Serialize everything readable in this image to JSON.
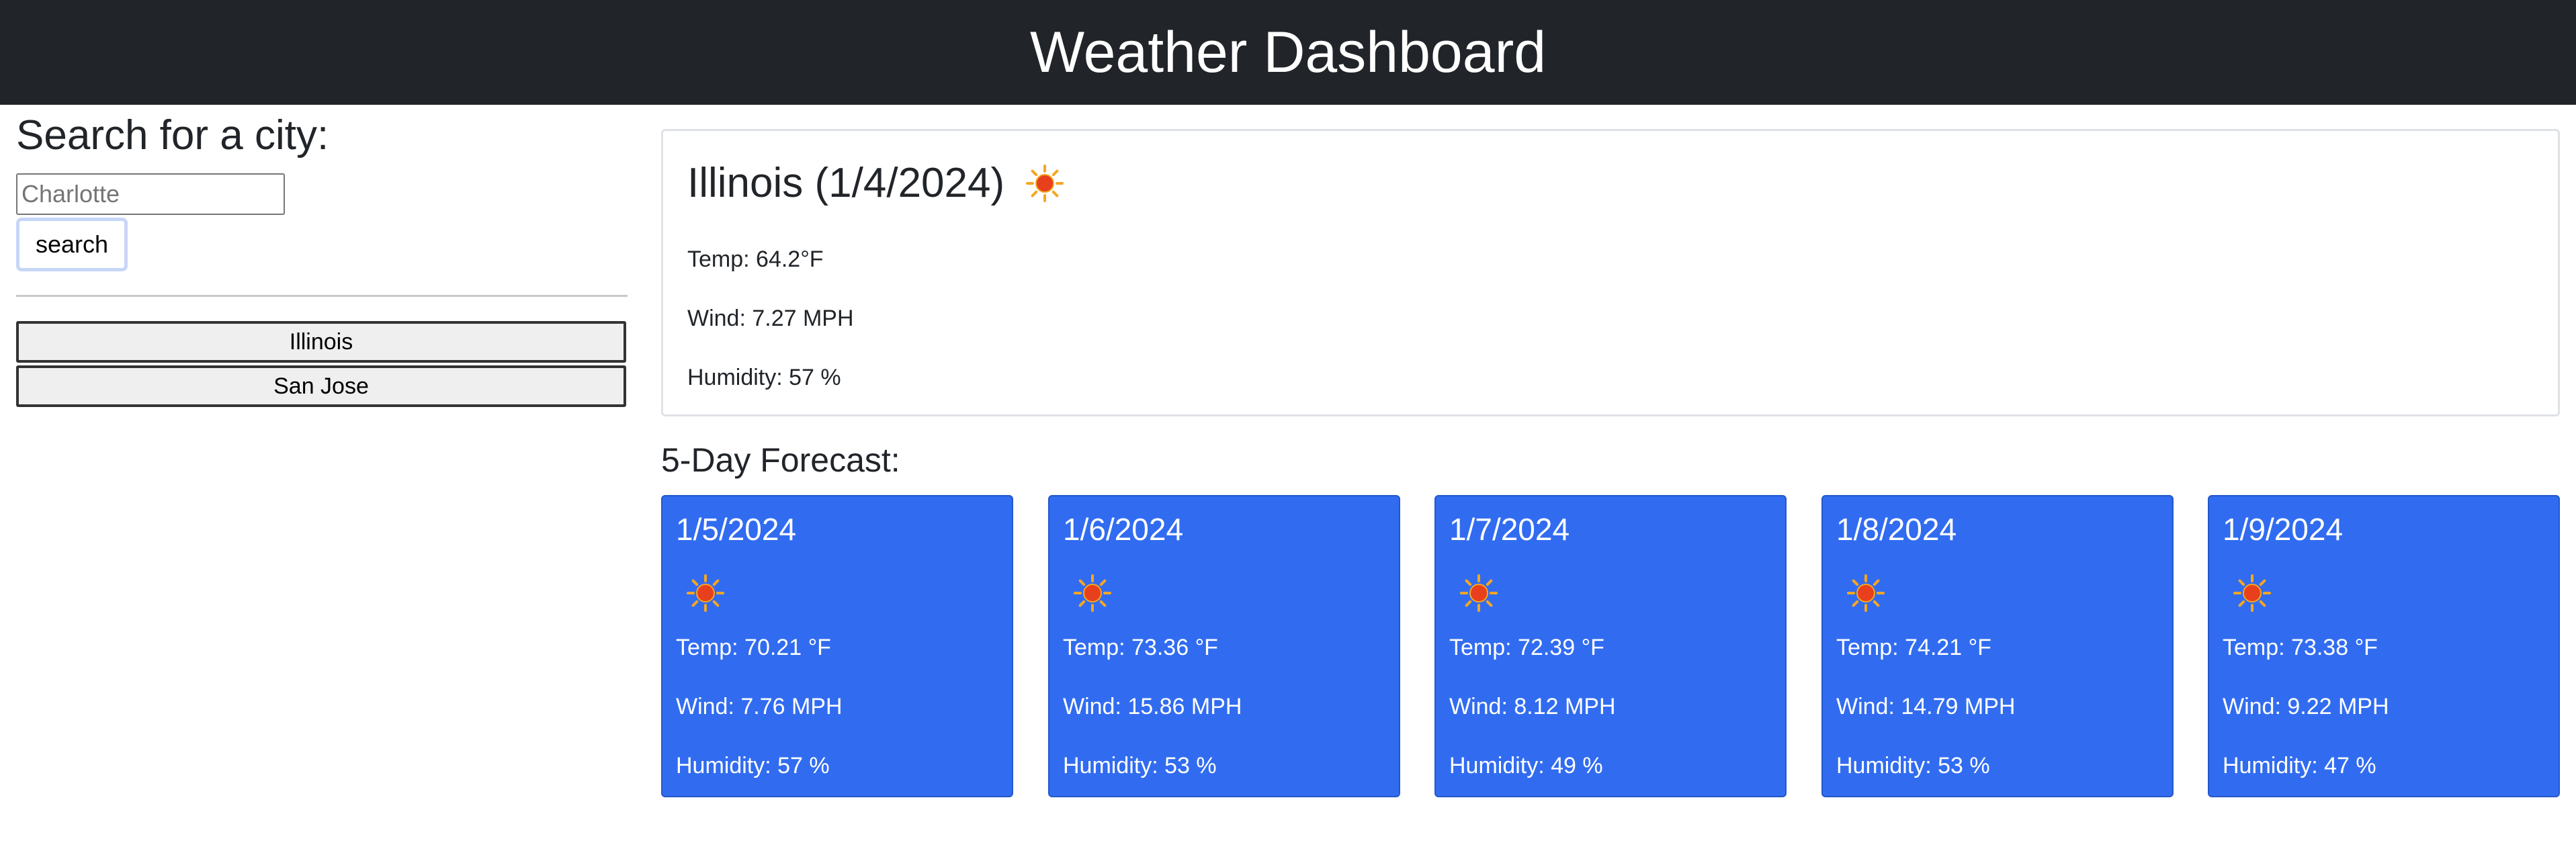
{
  "header": {
    "title": "Weather Dashboard"
  },
  "search": {
    "title": "Search for a city:",
    "placeholder": "Charlotte",
    "button_label": "search"
  },
  "history": [
    {
      "label": "Illinois"
    },
    {
      "label": "San Jose"
    }
  ],
  "current": {
    "title": "Illinois (1/4/2024)",
    "icon": "sun-icon",
    "temp": "Temp: 64.2°F",
    "wind": "Wind: 7.27 MPH",
    "humidity": "Humidity: 57 %"
  },
  "forecast": {
    "heading": "5-Day Forecast:",
    "days": [
      {
        "date": "1/5/2024",
        "icon": "sun-icon",
        "temp": "Temp: 70.21 °F",
        "wind": "Wind: 7.76 MPH",
        "humidity": "Humidity: 57 %"
      },
      {
        "date": "1/6/2024",
        "icon": "sun-icon",
        "temp": "Temp: 73.36 °F",
        "wind": "Wind: 15.86 MPH",
        "humidity": "Humidity: 53 %"
      },
      {
        "date": "1/7/2024",
        "icon": "sun-icon",
        "temp": "Temp: 72.39 °F",
        "wind": "Wind: 8.12 MPH",
        "humidity": "Humidity: 49 %"
      },
      {
        "date": "1/8/2024",
        "icon": "sun-icon",
        "temp": "Temp: 74.21 °F",
        "wind": "Wind: 14.79 MPH",
        "humidity": "Humidity: 53 %"
      },
      {
        "date": "1/9/2024",
        "icon": "sun-icon",
        "temp": "Temp: 73.38 °F",
        "wind": "Wind: 9.22 MPH",
        "humidity": "Humidity: 47 %"
      }
    ]
  },
  "colors": {
    "header_bg": "#212529",
    "forecast_card_bg": "#316cf0",
    "sun_core": "#e8401c",
    "sun_rays": "#f5a623"
  }
}
